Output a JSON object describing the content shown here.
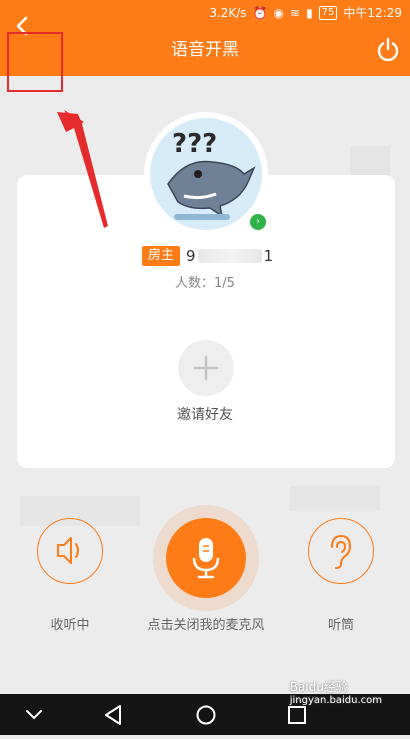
{
  "status_bar": {
    "network_speed": "3.2K/s",
    "battery": "75",
    "time": "中午12:29"
  },
  "header": {
    "title": "语音开黑"
  },
  "room": {
    "host_tag": "房主",
    "host_name_start": "9",
    "host_name_end": "1",
    "member_count": "人数：1/5",
    "invite_label": "邀请好友"
  },
  "controls": {
    "speaker_label": "收听中",
    "mic_label": "点击关闭我的麦克风",
    "earpiece_label": "听筒"
  },
  "watermark": {
    "brand": "Baidu经验",
    "url": "jingyan.baidu.com"
  },
  "colors": {
    "accent": "#fe7b16",
    "annotation_red": "#e52b2b",
    "online_green": "#2eb34b"
  },
  "icons": [
    "back-icon",
    "power-icon",
    "plus-icon",
    "speaker-icon",
    "microphone-icon",
    "ear-icon",
    "nav-back-icon",
    "nav-home-icon",
    "nav-recents-icon",
    "nav-down-icon"
  ]
}
